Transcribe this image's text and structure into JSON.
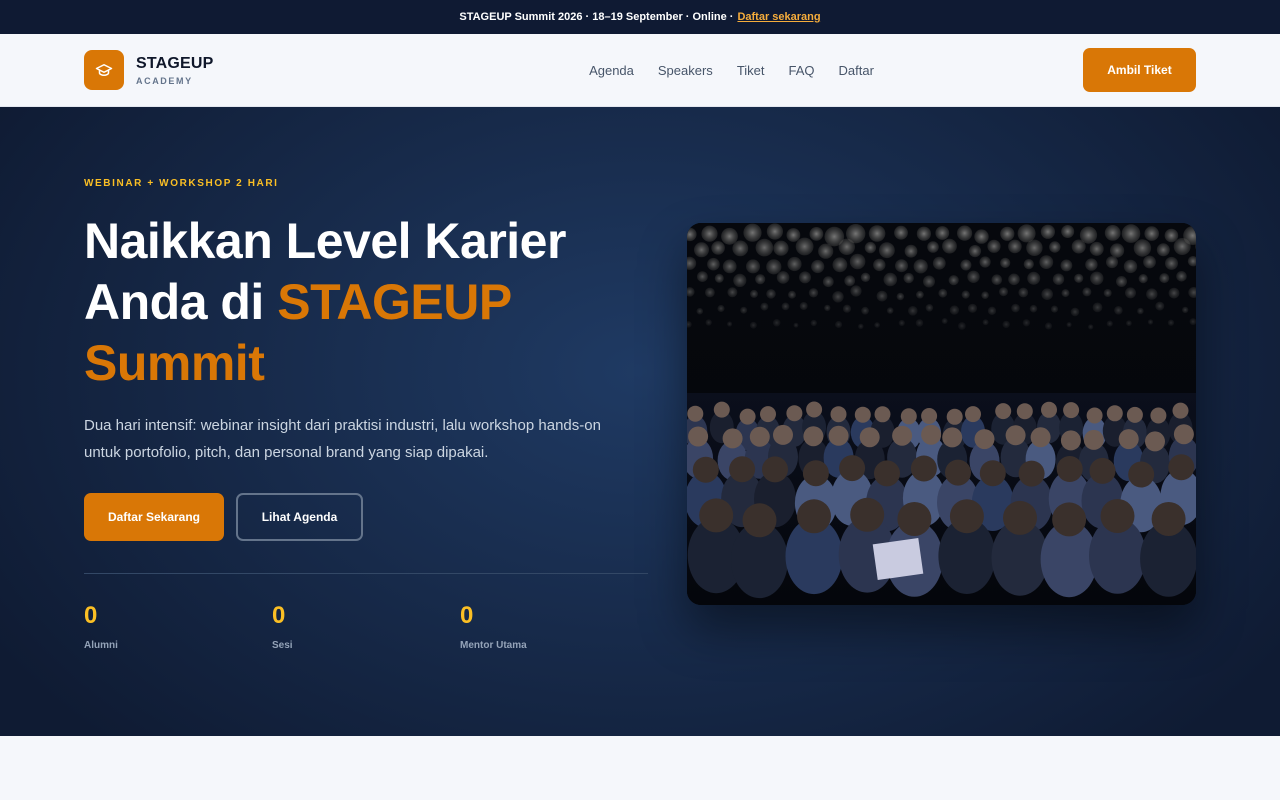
{
  "announcement": {
    "text": "STAGEUP Summit 2026 · 18–19 September · Online · ",
    "link": "Daftar sekarang"
  },
  "brand": {
    "name": "STAGEUP",
    "sub": "ACADEMY",
    "logo_icon": "graduation-cap-icon"
  },
  "nav": {
    "items": [
      {
        "label": "Agenda"
      },
      {
        "label": "Speakers"
      },
      {
        "label": "Tiket"
      },
      {
        "label": "FAQ"
      },
      {
        "label": "Daftar"
      }
    ],
    "cta": "Ambil Tiket"
  },
  "hero": {
    "eyebrow": "WEBINAR + WORKSHOP 2 HARI",
    "title_line1": "Naikkan Level Karier",
    "title_line2a": "Anda di ",
    "title_line2b": "STAGEUP",
    "title_line3": "Summit",
    "description": "Dua hari intensif: webinar insight dari praktisi industri, lalu workshop hands-on untuk portofolio, pitch, dan personal brand yang siap dipakai.",
    "primary_button": "Daftar Sekarang",
    "secondary_button": "Lihat Agenda",
    "stats": [
      {
        "value": "0",
        "label": "Alumni"
      },
      {
        "value": "0",
        "label": "Sesi"
      },
      {
        "value": "0",
        "label": "Mentor Utama"
      }
    ]
  },
  "colors": {
    "accent": "#d97706",
    "highlight": "#fbbf24",
    "hero_bg": "#1f3a63",
    "topbar_bg": "#0f1a33"
  }
}
